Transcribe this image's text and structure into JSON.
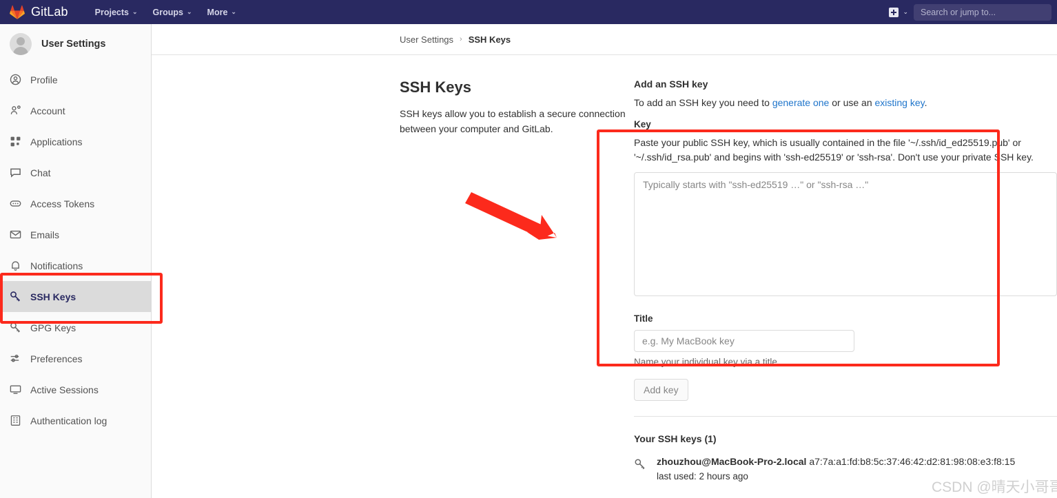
{
  "navbar": {
    "brand": "GitLab",
    "logo_icon": "gitlab-tanuki-logo",
    "links": [
      {
        "label": "Projects",
        "chevron": "⌄"
      },
      {
        "label": "Groups",
        "chevron": "⌄"
      },
      {
        "label": "More",
        "chevron": "⌄"
      }
    ],
    "plus_icon": "plus-square-icon",
    "plus_chevron": "⌄",
    "search_placeholder": "Search or jump to..."
  },
  "sidebar": {
    "user_name": "User Settings",
    "avatar_icon": "user-avatar-icon",
    "items": [
      {
        "label": "Profile",
        "icon": "profile-icon",
        "active": false
      },
      {
        "label": "Account",
        "icon": "account-icon",
        "active": false
      },
      {
        "label": "Applications",
        "icon": "applications-icon",
        "active": false
      },
      {
        "label": "Chat",
        "icon": "chat-icon",
        "active": false
      },
      {
        "label": "Access Tokens",
        "icon": "access-tokens-icon",
        "active": false
      },
      {
        "label": "Emails",
        "icon": "emails-icon",
        "active": false
      },
      {
        "label": "Notifications",
        "icon": "notifications-bell-icon",
        "active": false
      },
      {
        "label": "SSH Keys",
        "icon": "key-icon",
        "active": true
      },
      {
        "label": "GPG Keys",
        "icon": "key-icon",
        "active": false
      },
      {
        "label": "Preferences",
        "icon": "preferences-sliders-icon",
        "active": false
      },
      {
        "label": "Active Sessions",
        "icon": "monitor-icon",
        "active": false
      },
      {
        "label": "Authentication log",
        "icon": "log-grid-icon",
        "active": false
      }
    ]
  },
  "breadcrumb": {
    "parent": "User Settings",
    "separator": "›",
    "current": "SSH Keys"
  },
  "main": {
    "title": "SSH Keys",
    "description": "SSH keys allow you to establish a secure connection between your computer and GitLab.",
    "add_section": {
      "heading": "Add an SSH key",
      "desc_prefix": "To add an SSH key you need to ",
      "link_generate": "generate one",
      "desc_middle": " or use an ",
      "link_existing": "existing key",
      "desc_suffix": ".",
      "key_label": "Key",
      "key_help": "Paste your public SSH key, which is usually contained in the file '~/.ssh/id_ed25519.pub' or '~/.ssh/id_rsa.pub' and begins with 'ssh-ed25519' or 'ssh-rsa'. Don't use your private SSH key.",
      "key_placeholder": "Typically starts with \"ssh-ed25519 …\" or \"ssh-rsa …\"",
      "key_value": "",
      "title_label": "Title",
      "title_placeholder": "e.g. My MacBook key",
      "title_value": "",
      "title_help": "Name your individual key via a title",
      "submit_label": "Add key"
    },
    "keys_list": {
      "heading": "Your SSH keys (1)",
      "key_icon": "key-icon",
      "items": [
        {
          "name": "zhouzhou@MacBook-Pro-2.local",
          "fingerprint": "a7:7a:a1:fd:b8:5c:37:46:42:d2:81:98:08:e3:f8:15",
          "last_used": "last used: 2 hours ago"
        }
      ]
    }
  },
  "annotations": {
    "highlight_color": "#fc2a1c",
    "arrow_icon": "red-arrow-pointing-to-form"
  },
  "watermark": "CSDN @晴天小哥哥"
}
